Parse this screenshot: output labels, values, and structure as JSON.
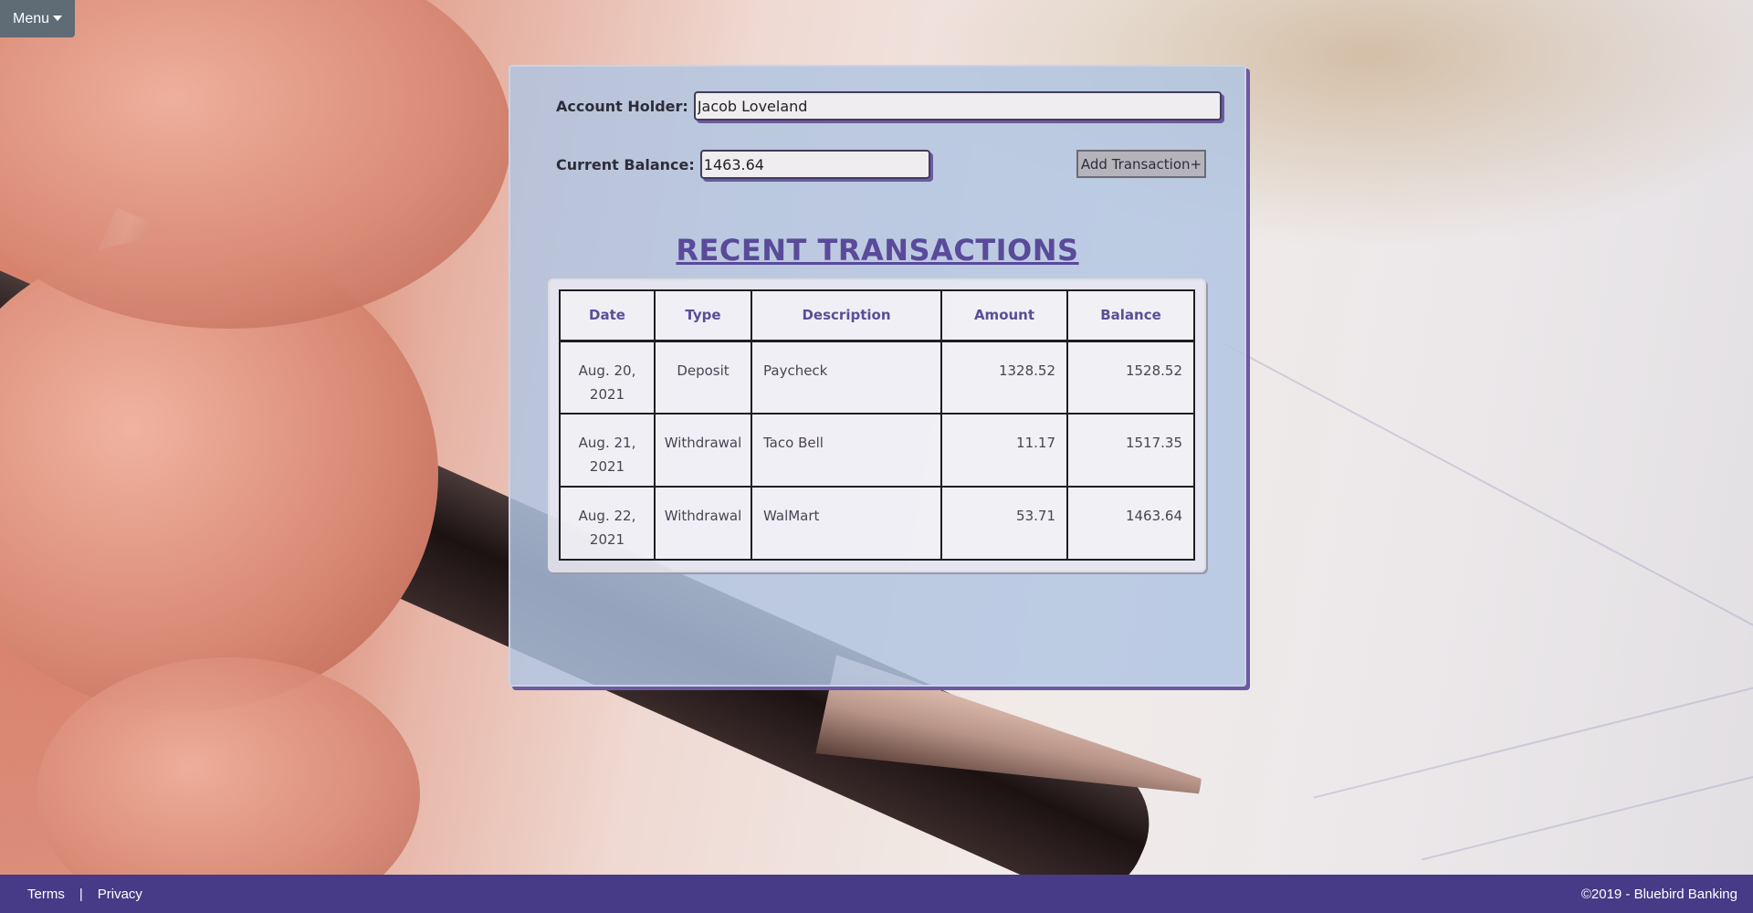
{
  "menu": {
    "label": "Menu"
  },
  "account": {
    "holder_label": "Account Holder:",
    "holder_value": "Jacob Loveland",
    "balance_label": "Current Balance:",
    "balance_value": "1463.64",
    "add_button_label": "Add Transaction+"
  },
  "transactions": {
    "title": "RECENT TRANSACTIONS",
    "headers": [
      "Date",
      "Type",
      "Description",
      "Amount",
      "Balance"
    ],
    "rows": [
      {
        "date_line1": "Aug. 20,",
        "date_line2": "2021",
        "type": "Deposit",
        "description": "Paycheck",
        "amount": "1328.52",
        "balance": "1528.52"
      },
      {
        "date_line1": "Aug. 21,",
        "date_line2": "2021",
        "type": "Withdrawal",
        "description": "Taco Bell",
        "amount": "11.17",
        "balance": "1517.35"
      },
      {
        "date_line1": "Aug. 22,",
        "date_line2": "2021",
        "type": "Withdrawal",
        "description": "WalMart",
        "amount": "53.71",
        "balance": "1463.64"
      }
    ]
  },
  "footer": {
    "terms": "Terms",
    "separator": "|",
    "privacy": "Privacy",
    "copyright": "©2019 - Bluebird Banking"
  },
  "colors": {
    "panel": "#b0c4e2",
    "accent": "#473a86",
    "title": "#5a4a9a"
  },
  "icons": {
    "menu_caret": "caret-down-icon"
  }
}
